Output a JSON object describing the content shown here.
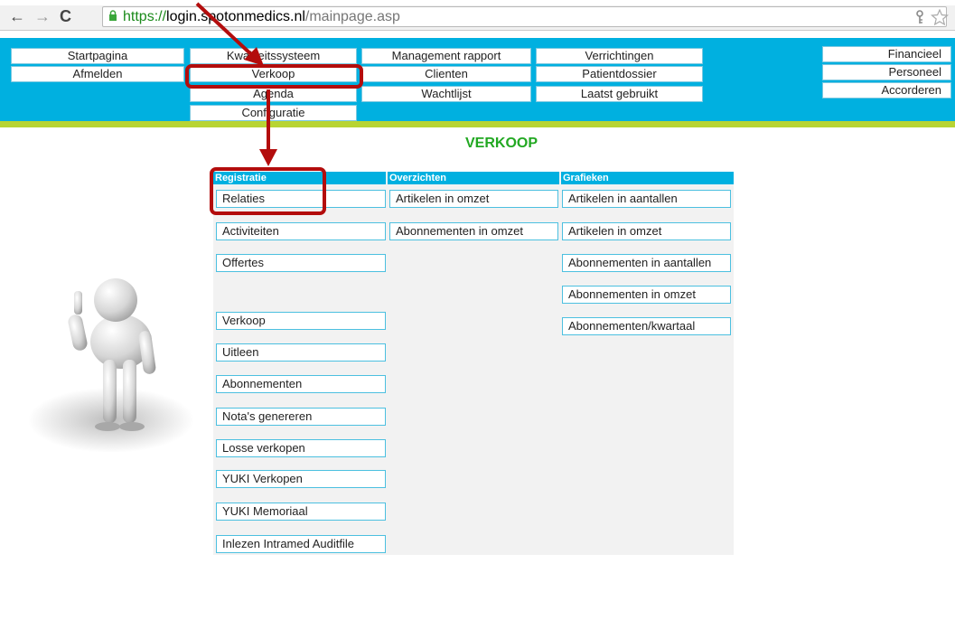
{
  "browser": {
    "back_glyph": "←",
    "forward_glyph": "→",
    "reload_glyph": "C",
    "url_scheme": "https://",
    "url_host": "login.spotonmedics.nl",
    "url_path": "/mainpage.asp",
    "icons": [
      "back-icon",
      "forward-icon",
      "reload-icon",
      "lock-icon",
      "key-icon",
      "star-icon"
    ]
  },
  "menu": {
    "col1": [
      "Startpagina",
      "Afmelden"
    ],
    "col2": [
      "Kwaliteitssysteem",
      "Verkoop",
      "Agenda",
      "Configuratie"
    ],
    "col3": [
      "Management rapport",
      "Clienten",
      "Wachtlijst"
    ],
    "col4": [
      "Verrichtingen",
      "Patientdossier",
      "Laatst gebruikt"
    ],
    "col5": [
      "Financieel",
      "Personeel",
      "Accorderen"
    ]
  },
  "page": {
    "title": "VERKOOP"
  },
  "columns": {
    "registratie": {
      "header": "Registratie",
      "items": [
        "Relaties",
        "Activiteiten",
        "Offertes",
        "Verkoop",
        "Uitleen",
        "Abonnementen",
        "Nota's genereren",
        "Losse verkopen",
        "YUKI Verkopen",
        "YUKI Memoriaal",
        "Inlezen Intramed Auditfile"
      ]
    },
    "overzichten": {
      "header": "Overzichten",
      "items": [
        "Artikelen in omzet",
        "Abonnementen in omzet"
      ]
    },
    "grafieken": {
      "header": "Grafieken",
      "items": [
        "Artikelen in aantallen",
        "Artikelen in omzet",
        "Abonnementen in aantallen",
        "Abonnementen in omzet",
        "Abonnementen/kwartaal"
      ]
    }
  },
  "annotation": {
    "color": "#b30d0d"
  },
  "colors": {
    "header": "#00b0e0",
    "accent_line": "#b8d433",
    "title": "#22a822"
  }
}
